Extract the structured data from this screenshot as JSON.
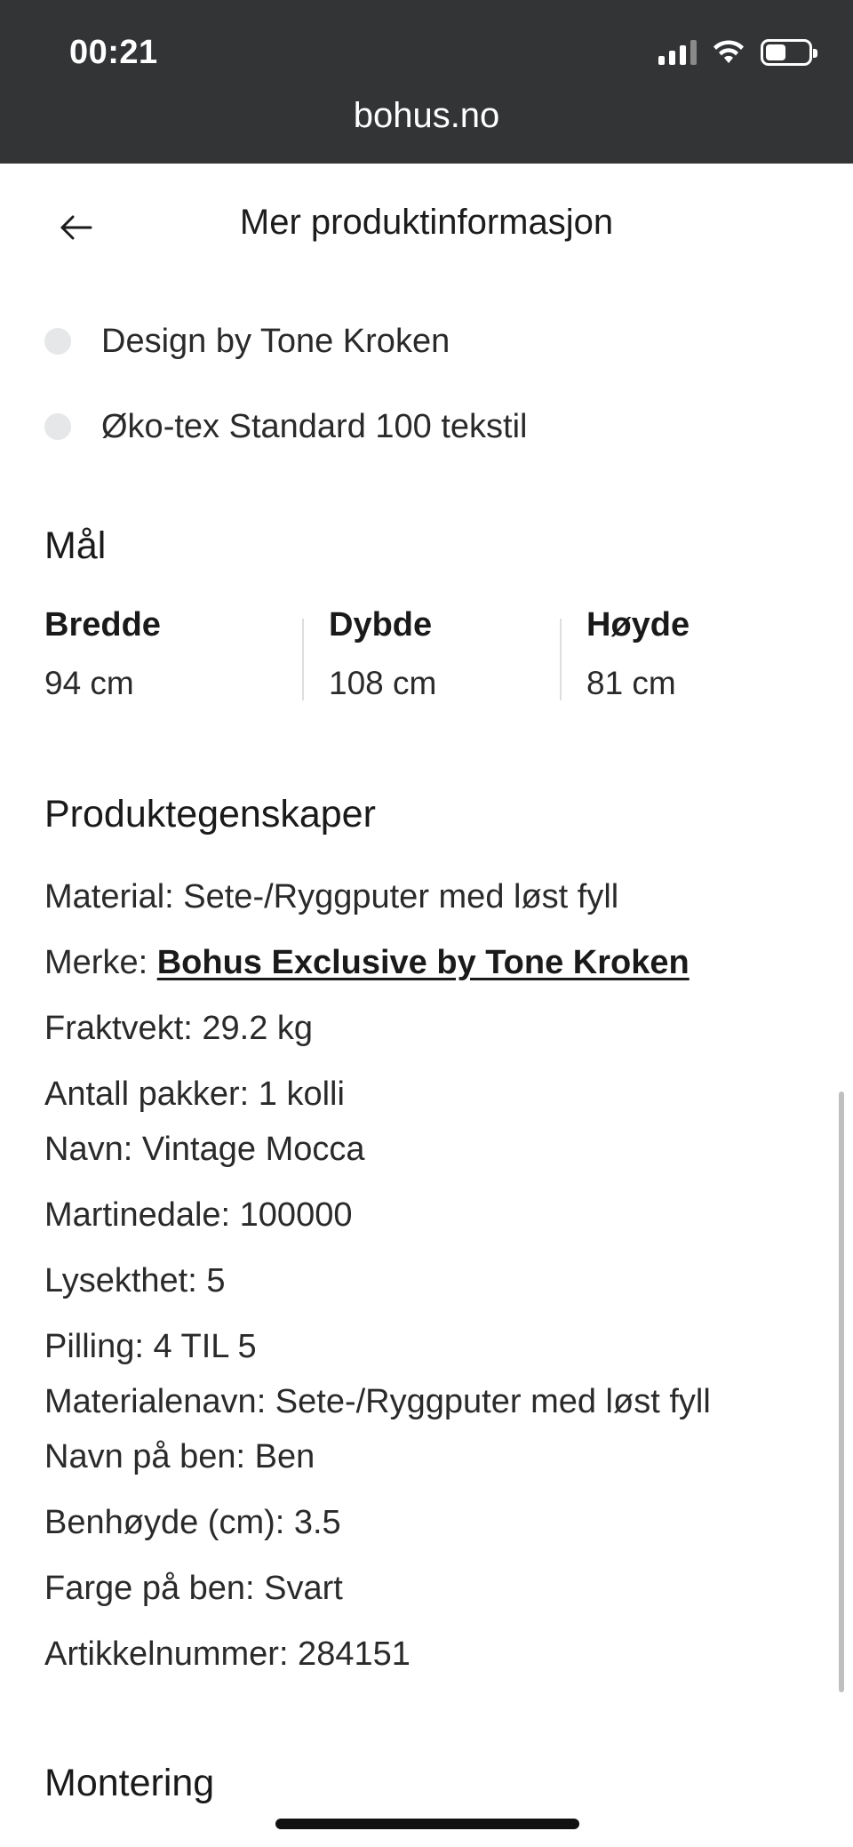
{
  "status": {
    "time": "00:21",
    "url": "bohus.no",
    "icons": [
      "signal-icon",
      "wifi-icon",
      "battery-icon"
    ]
  },
  "header": {
    "title": "Mer produktinformasjon",
    "back_icon": "arrow-left-icon"
  },
  "features": [
    "Design by Tone Kroken",
    "Øko-tex Standard 100 tekstil"
  ],
  "dimensions": {
    "title": "Mål",
    "items": [
      {
        "label": "Bredde",
        "value": "94 cm"
      },
      {
        "label": "Dybde",
        "value": "108 cm"
      },
      {
        "label": "Høyde",
        "value": "81 cm"
      }
    ]
  },
  "properties": {
    "title": "Produktegenskaper",
    "material": "Material: Sete-/Ryggputer med løst fyll",
    "brand_label": "Merke: ",
    "brand_link": "Bohus Exclusive by Tone Kroken",
    "items": [
      "Fraktvekt: 29.2 kg",
      "Antall pakker: 1 kolli",
      "Navn: Vintage Mocca",
      "Martinedale: 100000",
      "Lysekthet: 5",
      "Pilling: 4 TIL 5",
      "Materialenavn: Sete-/Ryggputer med løst fyll",
      "Navn på ben: Ben",
      "Benhøyde (cm): 3.5",
      "Farge på ben: Svart",
      "Artikkelnummer: 284151"
    ]
  },
  "assembly": {
    "title": "Montering"
  },
  "colors": {
    "status_bar": "#333436",
    "bullet_dot": "#e5e7e8",
    "text": "#1c1c1c"
  }
}
